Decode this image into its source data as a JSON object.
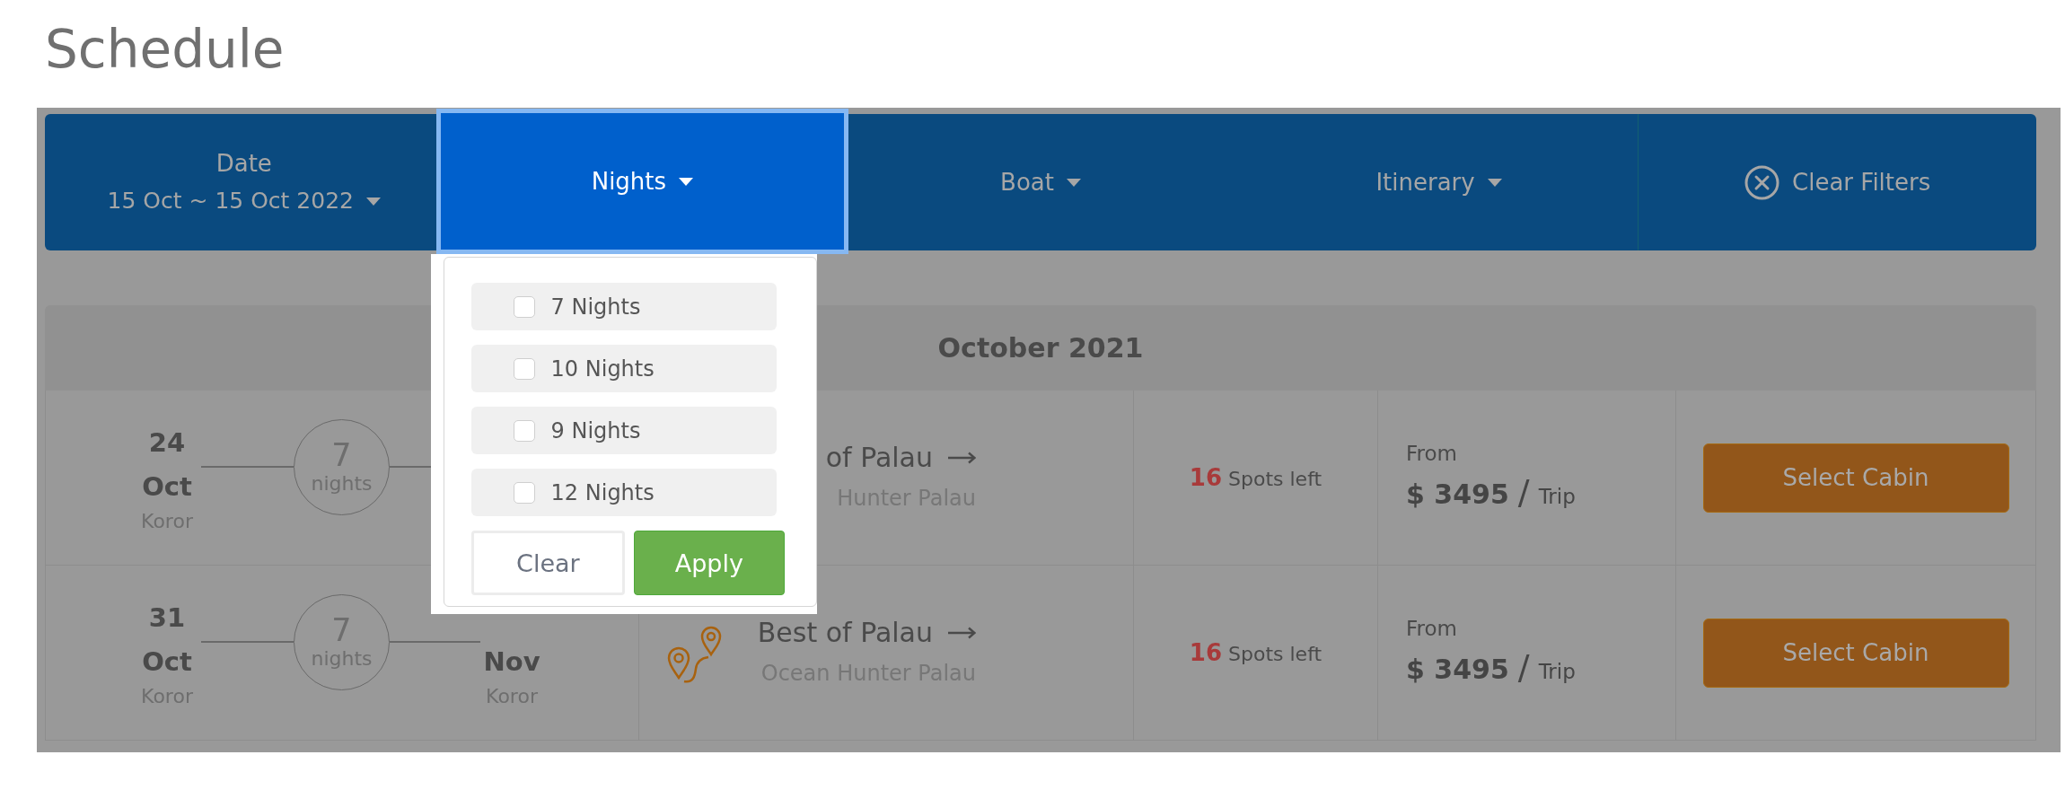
{
  "page": {
    "title": "Schedule"
  },
  "filters": [
    {
      "kind": "date",
      "label": "Date",
      "value": "15 Oct ~ 15 Oct 2022",
      "selected": false
    },
    {
      "kind": "dropdown",
      "label": "Nights",
      "selected": true,
      "menu": {
        "options": [
          {
            "label": "7 Nights",
            "checked": false
          },
          {
            "label": "10 Nights",
            "checked": false
          },
          {
            "label": "9 Nights",
            "checked": false
          },
          {
            "label": "12 Nights",
            "checked": false
          }
        ],
        "clear_button": "Clear",
        "apply_button": "Apply"
      }
    },
    {
      "kind": "dropdown",
      "label": "Boat",
      "selected": false
    },
    {
      "kind": "dropdown",
      "label": "Itinerary",
      "selected": false
    },
    {
      "kind": "clear",
      "label": "Clear Filters",
      "selected": false
    }
  ],
  "month": {
    "title": "October 2021"
  },
  "trips": [
    {
      "start": {
        "day": "24",
        "month": "Oct",
        "port": "Koror"
      },
      "duration": {
        "count": "7",
        "unit": "nights"
      },
      "itinerary": {
        "title": "of Palau",
        "operator": "Hunter Palau",
        "route_icon": false
      },
      "spots": {
        "count": "16",
        "label": "Spots left"
      },
      "price": {
        "prefix": "From",
        "amount": "$ 3495",
        "separator": "/",
        "unit": "Trip"
      },
      "action": "Select Cabin"
    },
    {
      "start": {
        "day": "31",
        "month": "Oct",
        "port": "Koror"
      },
      "duration": {
        "count": "7",
        "unit": "nights"
      },
      "end": {
        "month": "Nov",
        "port": "Koror"
      },
      "itinerary": {
        "title": "Best of Palau",
        "operator": "Ocean Hunter Palau",
        "route_icon": true
      },
      "spots": {
        "count": "16",
        "label": "Spots left"
      },
      "price": {
        "prefix": "From",
        "amount": "$ 3495",
        "separator": "/",
        "unit": "Trip"
      },
      "action": "Select Cabin"
    }
  ]
}
